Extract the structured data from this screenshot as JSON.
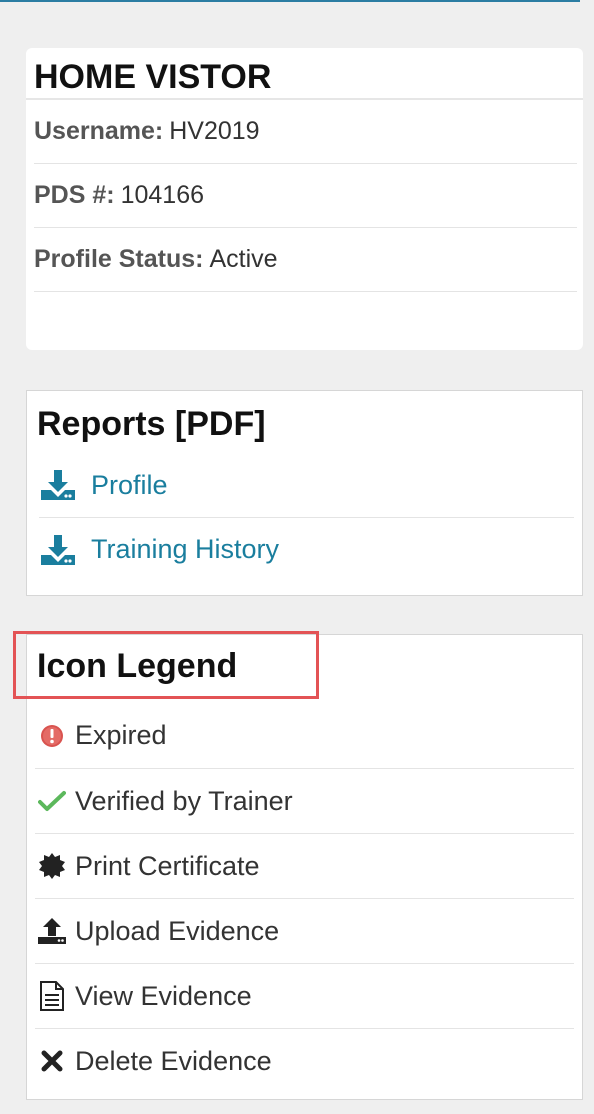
{
  "profile": {
    "title": "HOME VISTOR",
    "fields": [
      {
        "label": "Username:",
        "value": "HV2019"
      },
      {
        "label": "PDS #:",
        "value": "104166"
      },
      {
        "label": "Profile Status:",
        "value": "Active"
      }
    ]
  },
  "reports": {
    "title": "Reports [PDF]",
    "links": [
      {
        "label": "Profile",
        "icon": "download-icon"
      },
      {
        "label": "Training History",
        "icon": "download-icon"
      }
    ]
  },
  "legend": {
    "title": "Icon Legend",
    "items": [
      {
        "label": "Expired",
        "icon": "expired-icon"
      },
      {
        "label": "Verified by Trainer",
        "icon": "checkmark-icon"
      },
      {
        "label": "Print Certificate",
        "icon": "certificate-icon"
      },
      {
        "label": "Upload Evidence",
        "icon": "upload-icon"
      },
      {
        "label": "View Evidence",
        "icon": "document-icon"
      },
      {
        "label": "Delete Evidence",
        "icon": "delete-icon"
      }
    ]
  },
  "colors": {
    "link": "#1a7e9e",
    "highlight_border": "#e35355",
    "expired": "#d9534f",
    "verified": "#5cb85c"
  }
}
